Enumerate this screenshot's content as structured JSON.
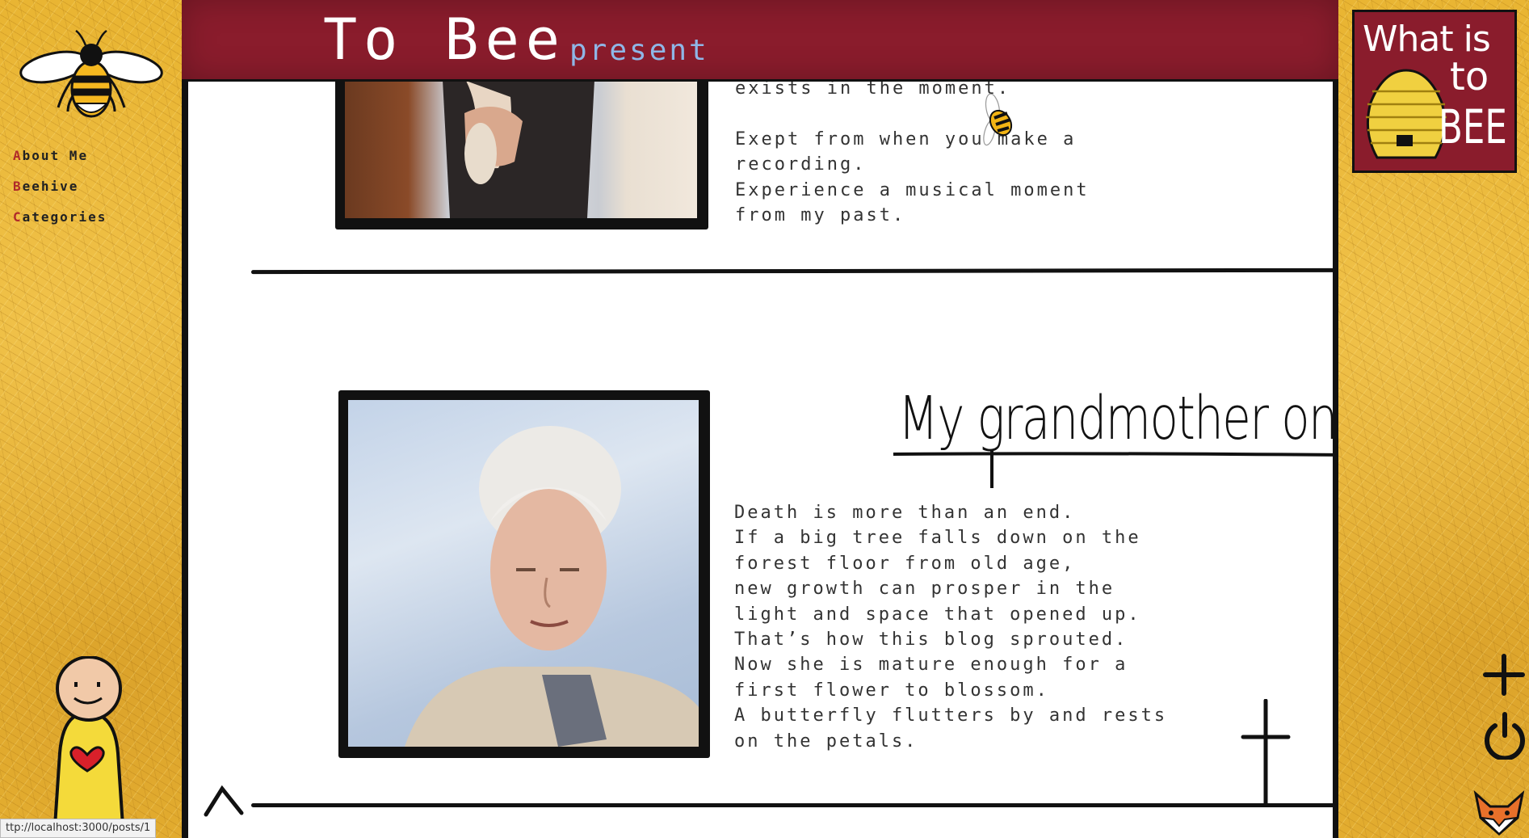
{
  "header": {
    "title": "To Bee",
    "subtitle": "present"
  },
  "nav": {
    "items": [
      {
        "first": "A",
        "rest": "bout Me"
      },
      {
        "first": "B",
        "rest": "eehive"
      },
      {
        "first": "C",
        "rest": "ategories"
      }
    ]
  },
  "logo": {
    "lines": [
      "What is",
      "to",
      "BEE"
    ]
  },
  "posts": [
    {
      "text": "exists in the moment.\n\nExept from when you make a\nrecording.\nExperience a musical moment\nfrom my past."
    },
    {
      "title": "My grandmother on a cloud",
      "text": "Death is more than an end.\nIf a big tree falls down on the\nforest floor from old age,\nnew growth can prosper in the\nlight and space that opened up.\nThat’s how this blog sprouted.\nNow she is mature enough for a\nfirst flower to blossom.\nA butterfly flutters by and rests\non the petals."
    }
  ],
  "status_bar": {
    "url": "ttp://localhost:3000/posts/1"
  },
  "colors": {
    "header": "#8a1c2c",
    "subtitle": "#8fb6e6",
    "nav_initial": "#b02a2a",
    "paper": "#e9b533"
  }
}
